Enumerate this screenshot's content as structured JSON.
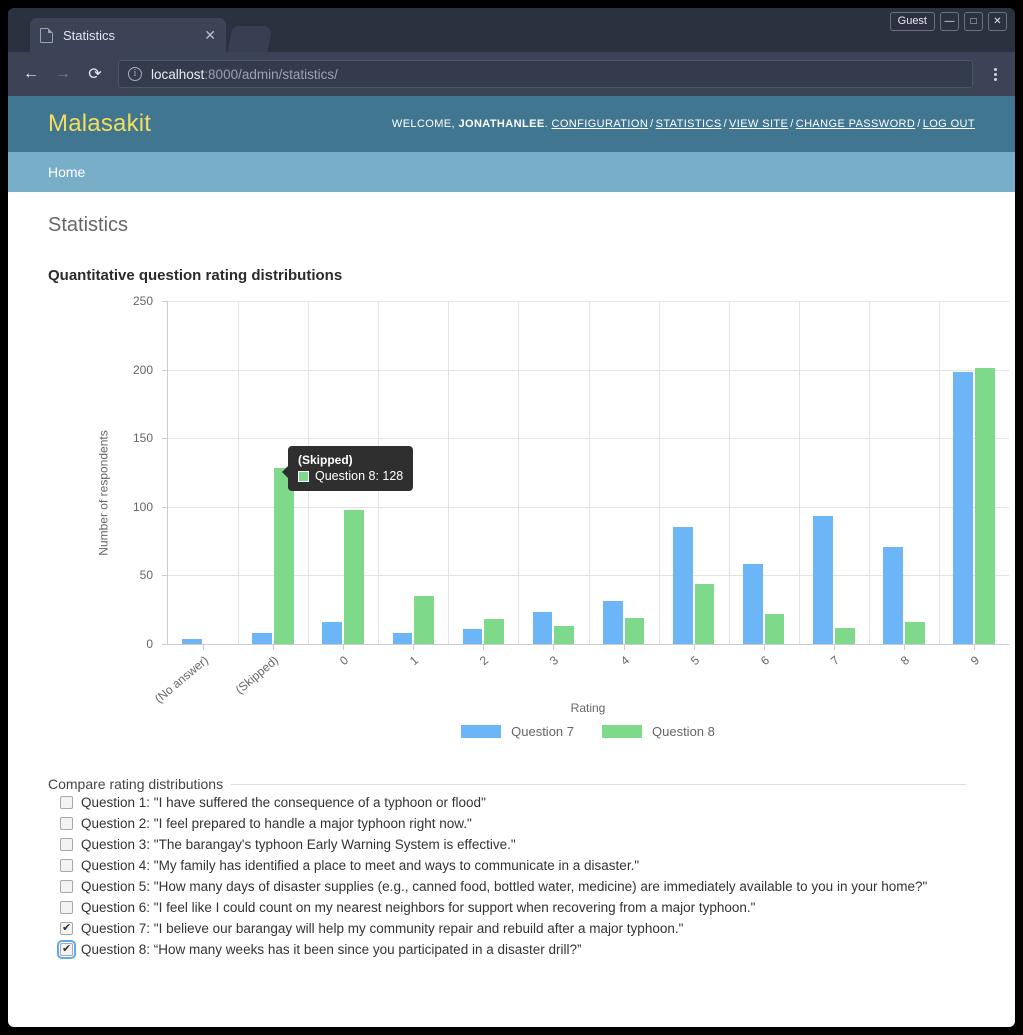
{
  "browser": {
    "tab_title": "Statistics",
    "tab_close_glyph": "✕",
    "guest_label": "Guest",
    "minimize_glyph": "—",
    "maximize_glyph": "□",
    "close_glyph": "✕",
    "back_glyph": "←",
    "forward_glyph": "→",
    "reload_glyph": "⟳",
    "info_glyph": "i",
    "url_host": "localhost",
    "url_rest": ":8000/admin/statistics/"
  },
  "site": {
    "brand": "Malasakit",
    "welcome_prefix": "WELCOME,",
    "username": "JONATHANLEE",
    "welcome_suffix": ".",
    "nav_links": [
      "CONFIGURATION",
      "STATISTICS",
      "VIEW SITE",
      "CHANGE PASSWORD",
      "LOG OUT"
    ],
    "separator": "/",
    "breadcrumb": "Home",
    "page_title": "Statistics"
  },
  "chart_data": {
    "type": "bar",
    "title": "Quantitative question rating distributions",
    "xlabel": "Rating",
    "ylabel": "Number of respondents",
    "ylim": [
      0,
      250
    ],
    "yticks": [
      0,
      50,
      100,
      150,
      200,
      250
    ],
    "grid": true,
    "legend_position": "bottom",
    "categories": [
      "(No answer)",
      "(Skipped)",
      "0",
      "1",
      "2",
      "3",
      "4",
      "5",
      "6",
      "7",
      "8",
      "9"
    ],
    "series": [
      {
        "name": "Question 7",
        "color": "#6cb6f7",
        "values": [
          4,
          8,
          16,
          8,
          11,
          23,
          31,
          85,
          58,
          93,
          71,
          198
        ]
      },
      {
        "name": "Question 8",
        "color": "#7fd98b",
        "values": [
          0,
          128,
          98,
          35,
          18,
          13,
          19,
          44,
          22,
          12,
          16,
          201
        ]
      }
    ],
    "tooltip": {
      "title": "(Skipped)",
      "series_name": "Question 8",
      "value": "128",
      "text": "Question 8: 128",
      "swatch_color": "#7fd98b"
    }
  },
  "fieldset": {
    "legend": "Compare rating distributions",
    "options": [
      {
        "label": "Question 1: \"I have suffered the consequence of a typhoon or flood\"",
        "checked": false,
        "focused": false
      },
      {
        "label": "Question 2: \"I feel prepared to handle a major typhoon right now.\"",
        "checked": false,
        "focused": false
      },
      {
        "label": "Question 3: \"The barangay's typhoon Early Warning System is effective.\"",
        "checked": false,
        "focused": false
      },
      {
        "label": "Question 4: \"My family has identified a place to meet and ways to communicate in a disaster.\"",
        "checked": false,
        "focused": false
      },
      {
        "label": "Question 5: \"How many days of disaster supplies (e.g., canned food, bottled water, medicine) are immediately available to you in your home?\"",
        "checked": false,
        "focused": false
      },
      {
        "label": "Question 6: \"I feel like I could count on my nearest neighbors for support when recovering from a major typhoon.\"",
        "checked": false,
        "focused": false
      },
      {
        "label": "Question 7: \"I believe our barangay will help my community repair and rebuild after a major typhoon.\"",
        "checked": true,
        "focused": false
      },
      {
        "label": "Question 8: “How many weeks has it been since you participated in a disaster drill?”",
        "checked": true,
        "focused": true
      }
    ]
  },
  "colors": {
    "header": "#417690",
    "breadcrumb_bar": "#79aec8",
    "brand_text": "#f5dd5d",
    "series_1": "#6cb6f7",
    "series_2": "#7fd98b"
  }
}
